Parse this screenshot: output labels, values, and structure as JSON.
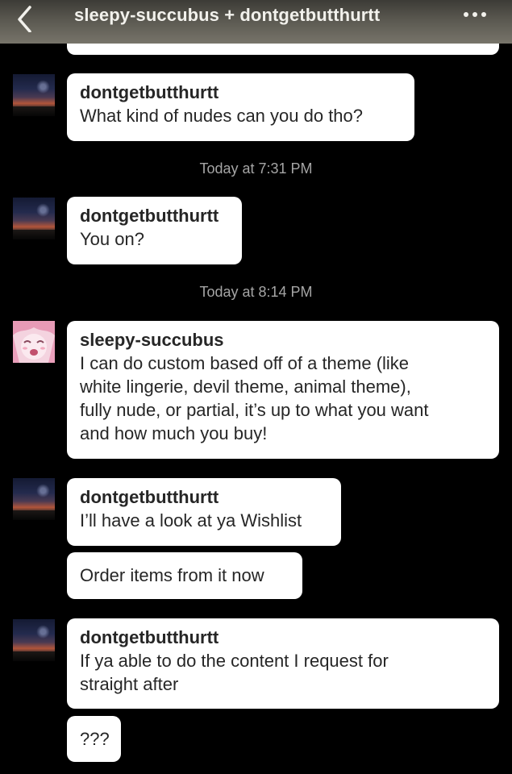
{
  "header": {
    "title": "sleepy-succubus + dontgetbutthurtt",
    "back_icon": "chevron-left-icon",
    "more_icon": "ellipsis-icon"
  },
  "timestamps": [
    "Today at 7:31 PM",
    "Today at 8:14 PM"
  ],
  "messages": [
    {
      "user": "dontgetbutthurtt",
      "text": "What kind of nudes can you do tho?"
    },
    {
      "user": "dontgetbutthurtt",
      "text": "You on?"
    },
    {
      "user": "sleepy-succubus",
      "text": "I can do custom based off of a theme (like\nwhite lingerie, devil theme, animal theme),\nfully nude, or partial, it’s up to what you want\nand how much you buy!"
    },
    {
      "user": "dontgetbutthurtt",
      "text": "I’ll have a look at ya Wishlist"
    },
    {
      "user": "",
      "text": "Order items from it now"
    },
    {
      "user": "dontgetbutthurtt",
      "text": "If ya able to do the content I request for\nstraight after"
    },
    {
      "user": "",
      "text": "???"
    }
  ],
  "colors": {
    "background": "#000000",
    "bubble": "#ffffff",
    "timestamp": "#a5a5a5"
  }
}
